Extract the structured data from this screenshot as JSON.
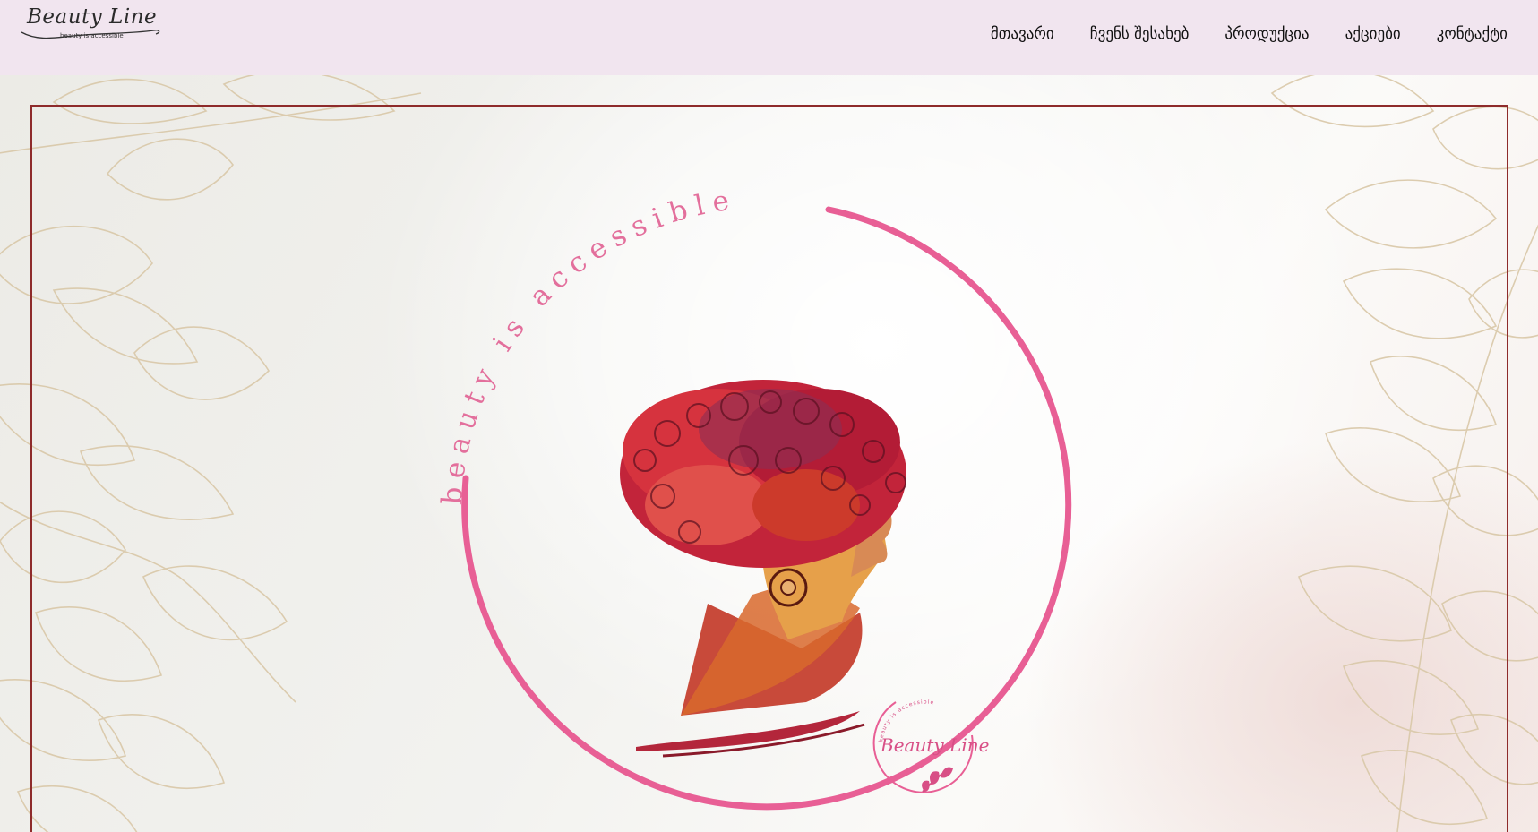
{
  "brand": {
    "name": "Beauty Line",
    "tagline": "beauty is accessible"
  },
  "nav": {
    "items": [
      {
        "label": "მთავარი"
      },
      {
        "label": "ჩვენს შესახებ"
      },
      {
        "label": "პროდუქცია"
      },
      {
        "label": "აქციები"
      },
      {
        "label": "კონტაქტი"
      }
    ]
  },
  "hero": {
    "circle_text": "beauty is accessible",
    "badge_title": "Beauty Line",
    "badge_sub": "beauty is accessible"
  },
  "colors": {
    "nav_bg": "#f1e5ef",
    "accent_pink": "#e85f95",
    "frame": "#8e2b2b",
    "leaf_line": "#d9c8a8"
  }
}
